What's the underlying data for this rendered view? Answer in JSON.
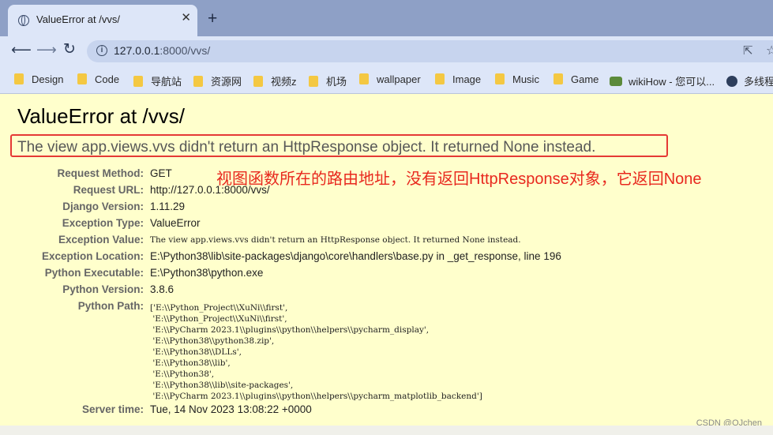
{
  "browser": {
    "tab_title": "ValueError at /vvs/",
    "tab_close": "✕",
    "new_tab": "+",
    "url_host": "127.0.0.1",
    "url_rest": ":8000/vvs/",
    "bookmarks": [
      "Design",
      "Code",
      "导航站",
      "资源网",
      "视频z",
      "机场",
      "wallpaper",
      "Image",
      "Music",
      "Game",
      "wikiHow - 您可以...",
      "多线程"
    ]
  },
  "page": {
    "title": "ValueError at /vvs/",
    "message": "The view app.views.vvs didn't return an HttpResponse object. It returned None instead.",
    "annotation": "视图函数所在的路由地址，没有返回HttpResponse对象，它返回None",
    "meta": [
      {
        "key": "Request Method:",
        "value": "GET"
      },
      {
        "key": "Request URL:",
        "value": "http://127.0.0.1:8000/vvs/"
      },
      {
        "key": "Django Version:",
        "value": "1.11.29"
      },
      {
        "key": "Exception Type:",
        "value": "ValueError"
      },
      {
        "key": "Exception Value:",
        "value": "The view app.views.vvs didn't return an HttpResponse object. It returned None instead."
      },
      {
        "key": "Exception Location:",
        "value": "E:\\Python38\\lib\\site-packages\\django\\core\\handlers\\base.py in _get_response, line 196"
      },
      {
        "key": "Python Executable:",
        "value": "E:\\Python38\\python.exe"
      },
      {
        "key": "Python Version:",
        "value": "3.8.6"
      },
      {
        "key": "Python Path:",
        "value": ""
      },
      {
        "key": "Server time:",
        "value": "Tue, 14 Nov 2023 13:08:22 +0000"
      }
    ],
    "python_path": [
      "['E:\\\\Python_Project\\\\XuNi\\\\first',",
      " 'E:\\\\Python_Project\\\\XuNi\\\\first',",
      " 'E:\\\\PyCharm 2023.1\\\\plugins\\\\python\\\\helpers\\\\pycharm_display',",
      " 'E:\\\\Python38\\\\python38.zip',",
      " 'E:\\\\Python38\\\\DLLs',",
      " 'E:\\\\Python38\\\\lib',",
      " 'E:\\\\Python38',",
      " 'E:\\\\Python38\\\\lib\\\\site-packages',",
      " 'E:\\\\PyCharm 2023.1\\\\plugins\\\\python\\\\helpers\\\\pycharm_matplotlib_backend']"
    ],
    "watermark": "CSDN @OJchen"
  }
}
